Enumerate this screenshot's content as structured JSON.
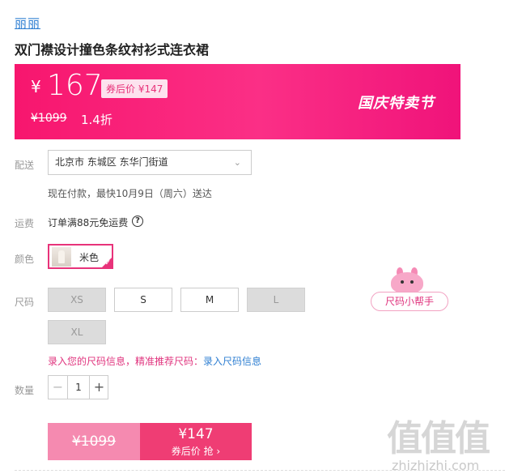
{
  "brand": "丽丽",
  "product_title": "双门襟设计撞色条纹衬衫式连衣裙",
  "price_banner": {
    "currency": "¥",
    "price": "167",
    "coupon_tag": "券后价 ¥147",
    "original_price": "¥1099",
    "discount": "1.4折",
    "festival": "国庆特卖节",
    "gradient_from": "#f7166e",
    "gradient_to": "#f0137a"
  },
  "delivery": {
    "label": "配送",
    "address": "北京市 东城区 东华门街道",
    "chevron": "⌄",
    "note": "现在付款，最快10月9日（周六）送达"
  },
  "shipping": {
    "label": "运费",
    "text": "订单满88元免运费",
    "help_glyph": "?"
  },
  "color": {
    "label": "颜色",
    "selected": "米色",
    "accent": "#e8337a"
  },
  "size": {
    "label": "尺码",
    "options": [
      {
        "name": "XS",
        "available": false
      },
      {
        "name": "S",
        "available": true
      },
      {
        "name": "M",
        "available": true
      },
      {
        "name": "L",
        "available": false
      },
      {
        "name": "XL",
        "available": false
      }
    ],
    "hint_text": "录入您的尺码信息，精准推荐尺码：",
    "hint_link": "录入尺码信息",
    "helper_label": "尺码小帮手"
  },
  "quantity": {
    "label": "数量",
    "value": "1",
    "minus": "−",
    "plus": "+"
  },
  "buy": {
    "original_price": "¥1099",
    "coupon_price": "¥147",
    "coupon_action": "券后价 抢 ›"
  },
  "watermark": {
    "glyphs": "值值值",
    "domain": "zhizhizhi.com"
  }
}
